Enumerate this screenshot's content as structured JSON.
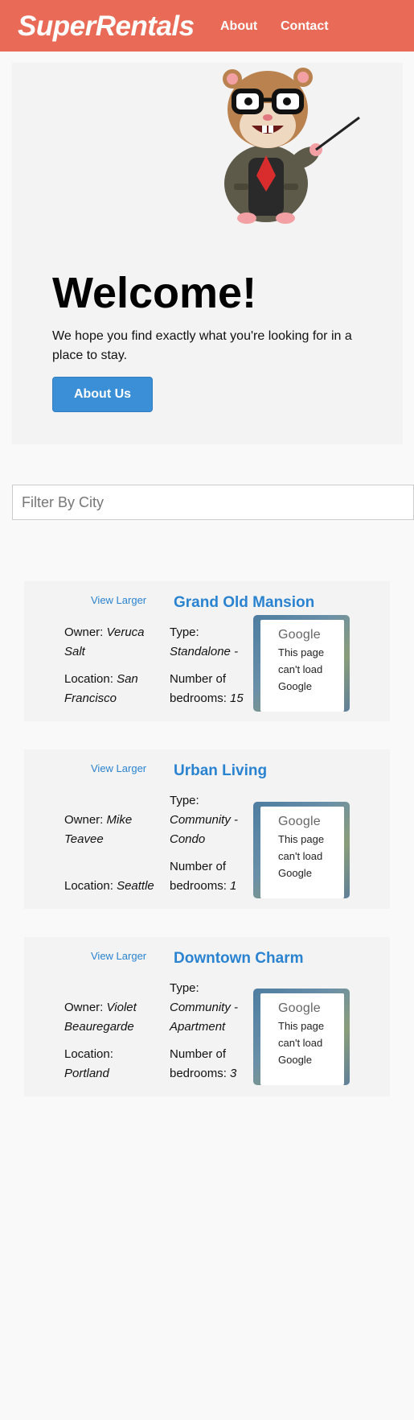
{
  "nav": {
    "brand": "SuperRentals",
    "about": "About",
    "contact": "Contact"
  },
  "hero": {
    "title": "Welcome!",
    "lead": "We hope you find exactly what you're looking for in a place to stay.",
    "button": "About Us"
  },
  "filter": {
    "placeholder": "Filter By City",
    "value": ""
  },
  "listings": [
    {
      "view_larger": "View Larger",
      "title": "Grand Old Mansion",
      "owner_label": "Owner:",
      "owner": "Veruca Salt",
      "type_label": "Type:",
      "type": "Standalone - Estate",
      "location_label": "Location:",
      "location": "San Francisco",
      "bedrooms_label": "Number of bedrooms:",
      "bedrooms": "15",
      "map_brand": "Google",
      "map_message": "This page can't load Google"
    },
    {
      "view_larger": "View Larger",
      "title": "Urban Living",
      "owner_label": "Owner:",
      "owner": "Mike Teavee",
      "type_label": "Type:",
      "type": "Community - Condo",
      "location_label": "Location:",
      "location": "Seattle",
      "bedrooms_label": "Number of bedrooms:",
      "bedrooms": "1",
      "map_brand": "Google",
      "map_message": "This page can't load Google"
    },
    {
      "view_larger": "View Larger",
      "title": "Downtown Charm",
      "owner_label": "Owner:",
      "owner": "Violet Beauregarde",
      "type_label": "Type:",
      "type": "Community - Apartment",
      "location_label": "Location:",
      "location": "Portland",
      "bedrooms_label": "Number of bedrooms:",
      "bedrooms": "3",
      "map_brand": "Google",
      "map_message": "This page can't load Google"
    }
  ],
  "colors": {
    "header": "#e96b57",
    "accent_blue": "#2a83d0",
    "button_blue": "#3a8fd6"
  },
  "icons": {
    "hero_image": "tomster-mascot"
  }
}
